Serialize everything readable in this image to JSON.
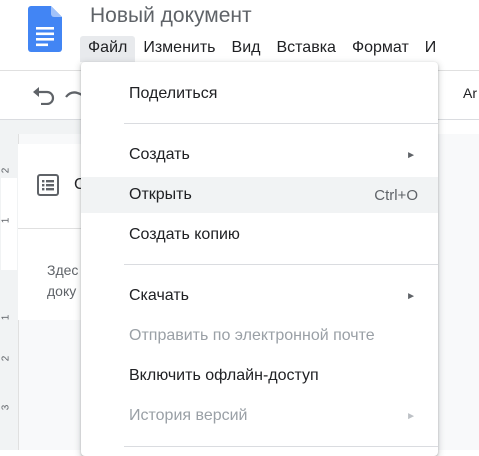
{
  "document": {
    "title": "Новый документ"
  },
  "menubar": {
    "items": [
      "Файл",
      "Изменить",
      "Вид",
      "Вставка",
      "Формат",
      "И"
    ],
    "active_index": 0
  },
  "toolbar": {
    "font_name": "Ar"
  },
  "ruler": {
    "numbers": [
      "2",
      "1",
      "1",
      "2",
      "3"
    ]
  },
  "outline": {
    "heading": "С",
    "text_line1": "Здес",
    "text_line2": "доку"
  },
  "file_menu": {
    "items": [
      {
        "label": "Поделиться"
      },
      {
        "label": "Создать",
        "submenu": true,
        "arrow": "►"
      },
      {
        "label": "Открыть",
        "shortcut": "Ctrl+O",
        "highlighted": true
      },
      {
        "label": "Создать копию"
      },
      {
        "label": "Скачать",
        "submenu": true,
        "arrow": "►"
      },
      {
        "label": "Отправить по электронной почте",
        "disabled": true
      },
      {
        "label": "Включить офлайн-доступ"
      },
      {
        "label": "История версий",
        "submenu": true,
        "disabled": true,
        "arrow": "►"
      }
    ]
  },
  "colors": {
    "docs_blue": "#4285f4",
    "menu_highlight": "#f1f3f4",
    "disabled_text": "#9aa0a6"
  }
}
